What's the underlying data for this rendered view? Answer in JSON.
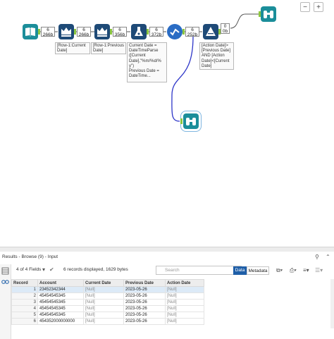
{
  "canvas": {
    "badges": [
      "6\n266b",
      "6\n266b",
      "6\n356b",
      "6\n372b",
      "6\n252b",
      "0\n0b"
    ],
    "annotations": [
      "[Row-1:Current\nDate]",
      "[Row-1:Previous\nDate]",
      "Current Date =\nDateTimeParse\n([Current\nDate],\"%m/%d/%\ny\")\nPrevious Date =\nDateTime...",
      "[Action Date]>\n[Previous Date]\nAND [Action\nDate]<[Current\nDate]"
    ],
    "zoom_out": "−",
    "zoom_in": "+",
    "colors": {
      "accent": "#1b8e9a",
      "connection": "#2d35c8",
      "anchor": "#8bc63f"
    }
  },
  "results": {
    "title": "Results - Browse (9) - Input",
    "fields_label": "4 of 4 Fields",
    "records_info": "6 records displayed, 1629 bytes",
    "search_placeholder": "Search",
    "tab_data": "Data",
    "tab_metadata": "Metadata"
  },
  "table": {
    "columns": [
      "Record",
      "Account",
      "Current Date",
      "Previous Date",
      "Action Date"
    ],
    "rows": [
      [
        "1",
        "23452342344",
        "[Null]",
        "2023-05-26",
        "[Null]"
      ],
      [
        "2",
        "45454545345",
        "[Null]",
        "2023-05-26",
        "[Null]"
      ],
      [
        "3",
        "45454545345",
        "[Null]",
        "2023-05-26",
        "[Null]"
      ],
      [
        "4",
        "45454545345",
        "[Null]",
        "2023-05-26",
        "[Null]"
      ],
      [
        "5",
        "45454545345",
        "[Null]",
        "2023-05-26",
        "[Null]"
      ],
      [
        "6",
        "454352000000000",
        "[Null]",
        "2023-05-26",
        "[Null]"
      ]
    ]
  }
}
